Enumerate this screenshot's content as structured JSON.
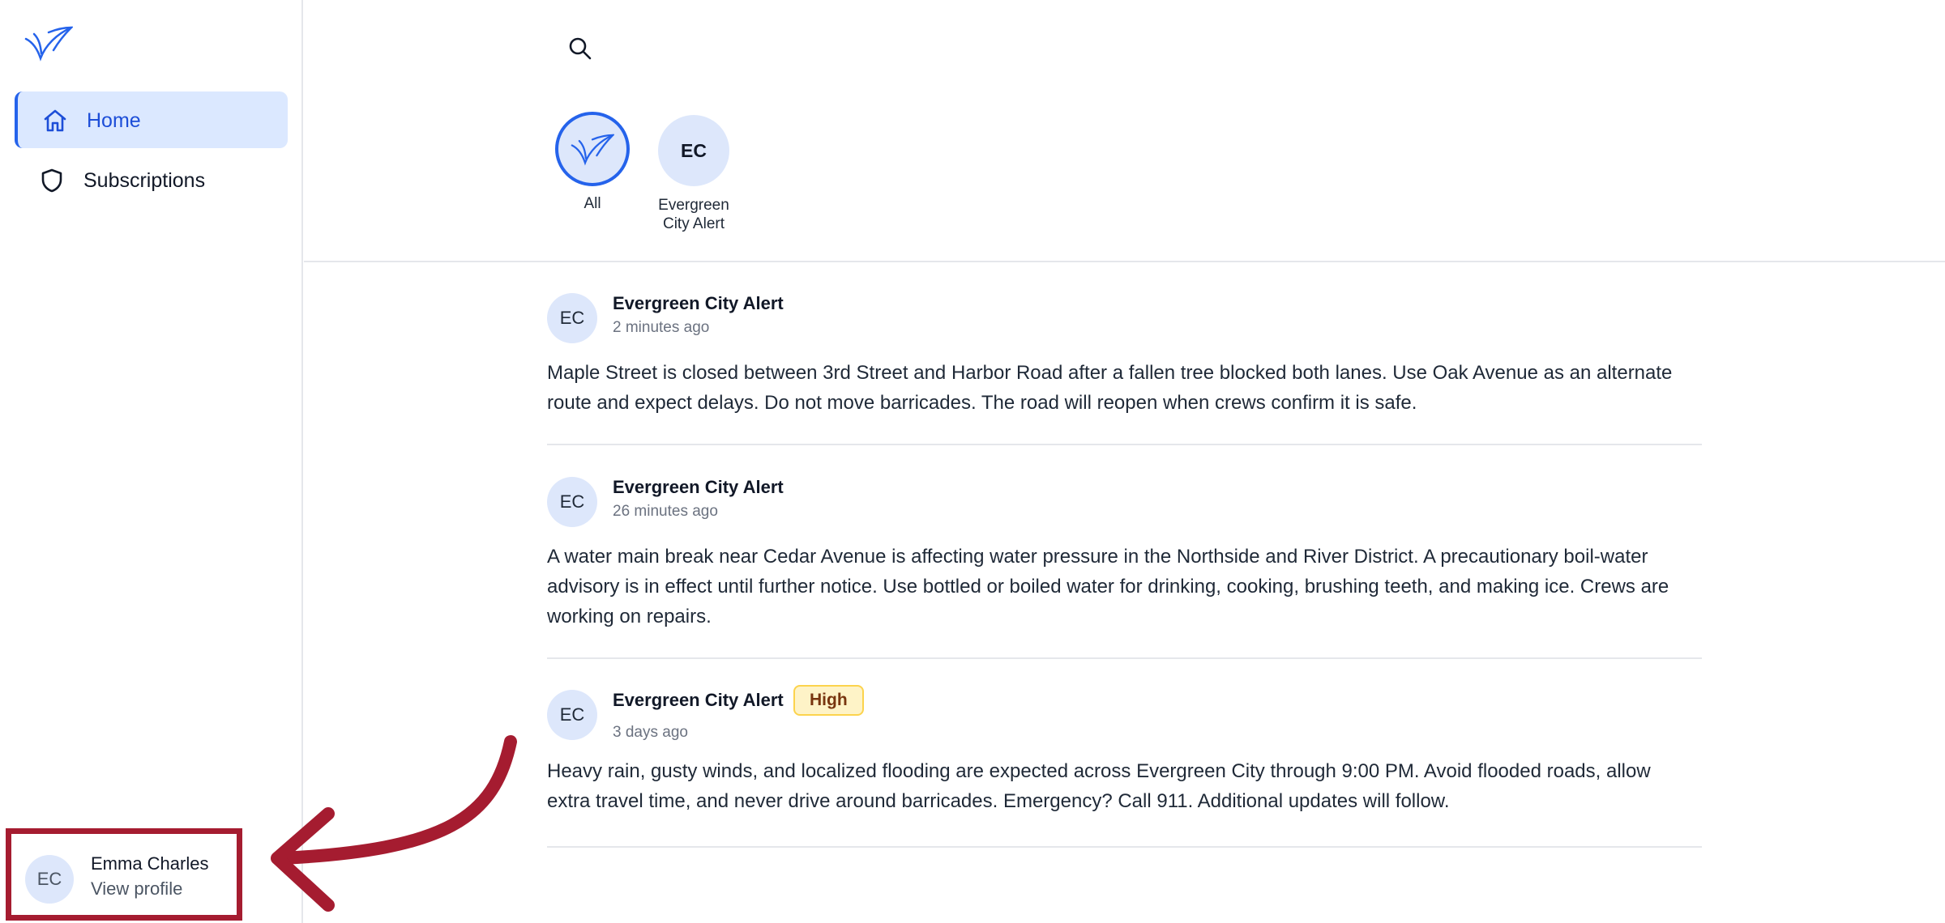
{
  "sidebar": {
    "logo_icon": "checkmark-wing-logo",
    "items": [
      {
        "label": "Home",
        "icon": "home-icon",
        "active": true
      },
      {
        "label": "Subscriptions",
        "icon": "shield-icon",
        "active": false
      }
    ],
    "profile": {
      "initials": "EC",
      "name": "Emma Charles",
      "link": "View profile"
    }
  },
  "header": {
    "search_icon": "search-icon",
    "filters": [
      {
        "label": "All",
        "icon": "checkmark-wing-logo",
        "selected": true
      },
      {
        "initials": "EC",
        "label_line1": "Evergreen",
        "label_line2": "City Alert",
        "selected": false
      }
    ]
  },
  "feed": {
    "posts": [
      {
        "initials": "EC",
        "sender": "Evergreen City Alert",
        "time": "2 minutes ago",
        "badge": "",
        "body": "Maple Street is closed between 3rd Street and Harbor Road after a fallen tree blocked both lanes. Use Oak Avenue as an alternate route and expect delays. Do not move barricades. The road will reopen when crews confirm it is safe."
      },
      {
        "initials": "EC",
        "sender": "Evergreen City Alert",
        "time": "26 minutes ago",
        "badge": "",
        "body": "A water main break near Cedar Avenue is affecting water pressure in the Northside and River District. A precautionary boil-water advisory is in effect until further notice. Use bottled or boiled water for drinking, cooking, brushing teeth, and making ice. Crews are working on repairs."
      },
      {
        "initials": "EC",
        "sender": "Evergreen City Alert",
        "time": "3 days ago",
        "badge": "High",
        "body": "Heavy rain, gusty winds, and localized flooding are expected across Evergreen City through 9:00 PM. Avoid flooded roads, allow extra travel time, and never drive around barricades. Emergency? Call 911. Additional updates will follow."
      }
    ]
  },
  "colors": {
    "accent": "#2563eb",
    "active_bg": "#dbe8ff",
    "avatar_bg": "#dde7fb",
    "highlight_border": "#a51c30",
    "badge_bg": "#fef3c7"
  }
}
